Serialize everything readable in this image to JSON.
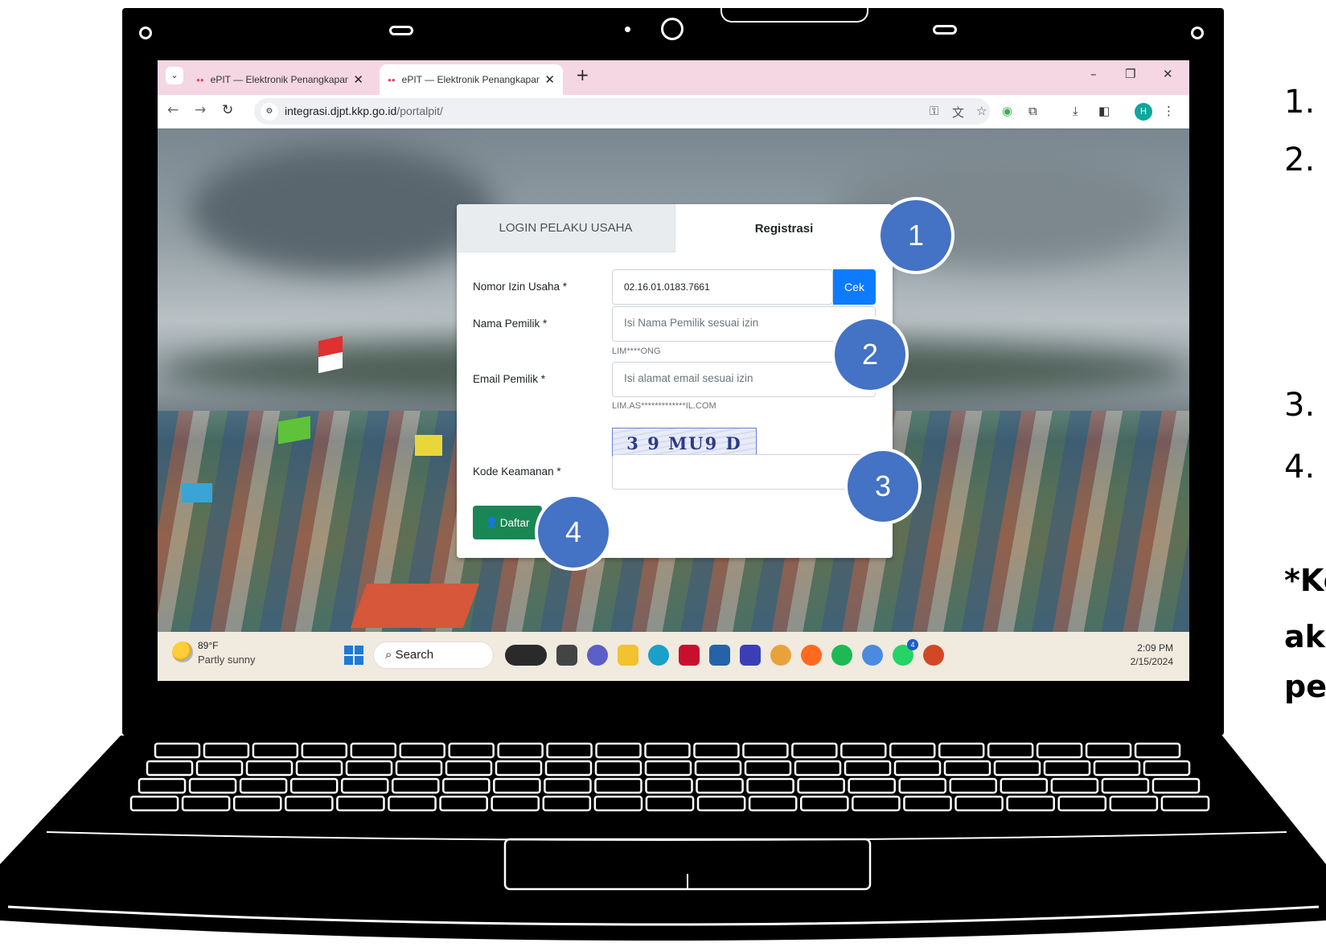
{
  "browser": {
    "tabs": [
      {
        "title": "ePIT — Elektronik Penangkapan",
        "favicon": "epit-favicon"
      },
      {
        "title": "ePIT — Elektronik Penangkapan",
        "favicon": "epit-favicon"
      }
    ],
    "new_tab_label": "+",
    "url_host": "integrasi.djpt.kkp.go.id",
    "url_path": "/portalpit/",
    "profile_initial": "H"
  },
  "form": {
    "tab_login": "LOGIN PELAKU USAHA",
    "tab_register": "Registrasi",
    "fields": {
      "nib_label": "Nomor Izin Usaha *",
      "nib_value": "02.16.01.0183.7661",
      "check_button": "Cek",
      "owner_label": "Nama Pemilik *",
      "owner_placeholder": "Isi Nama Pemilik sesuai izin",
      "owner_hint": "LIM****ONG",
      "email_label": "Email Pemilik *",
      "email_placeholder": "Isi alamat email sesuai izin",
      "email_hint": "LIM.AS*************IL.COM",
      "captcha_text": "3 9 MU9 D",
      "security_label": "Kode Keamanan *",
      "security_value": ""
    },
    "submit_button": "Daftar"
  },
  "markers": [
    "1",
    "2",
    "3",
    "4"
  ],
  "taskbar": {
    "temperature": "89°F",
    "weather": "Partly sunny",
    "search_label": "Search",
    "time": "2:09 PM",
    "date": "2/15/2024",
    "badge_whatsapp": "4"
  },
  "side_text": {
    "items": [
      "1.",
      "2.",
      "3.",
      "4."
    ],
    "note_lines": [
      "*Ke",
      "ak",
      "pe"
    ]
  },
  "colors": {
    "marker": "#4472c4",
    "check_button": "#0d7bff",
    "submit_button": "#198754",
    "tabbar": "#f5d6e3"
  }
}
